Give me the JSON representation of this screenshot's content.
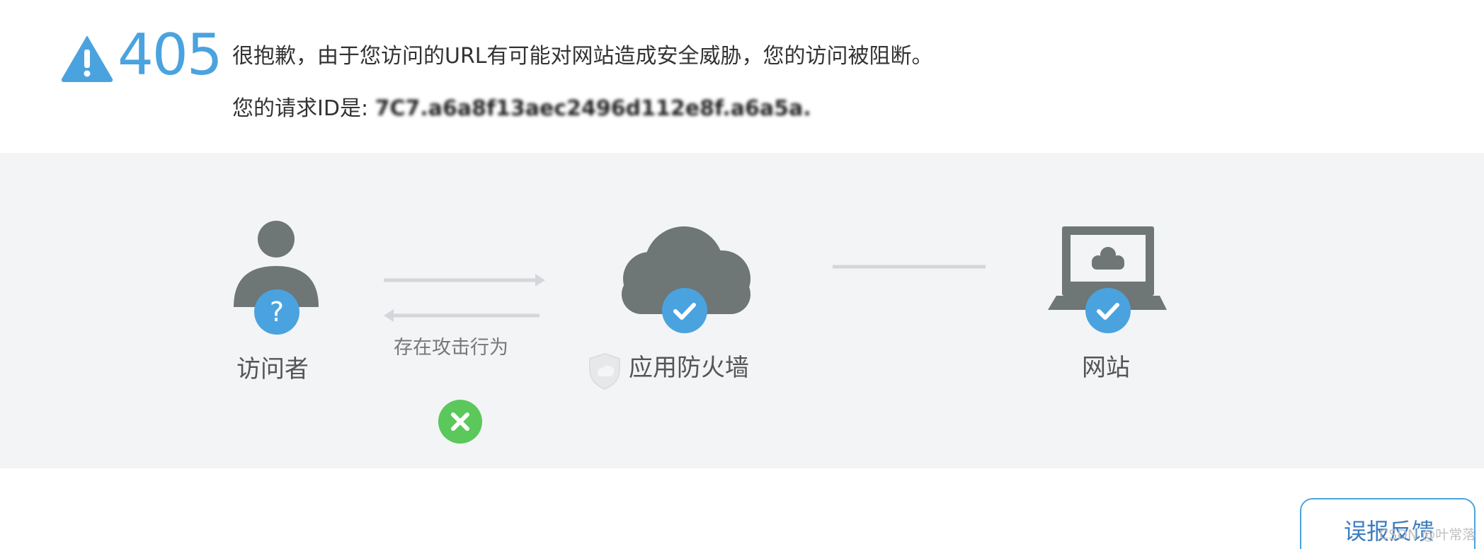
{
  "header": {
    "error_code": "405",
    "message": "很抱歉，由于您访问的URL有可能对网站造成安全威胁，您的访问被阻断。",
    "request_id_label": "您的请求ID是: ",
    "request_id_value": "7C7.a6a8f13aec2496d112e8f.a6a5a."
  },
  "flow": {
    "visitor": {
      "label": "访问者",
      "icon": "user-icon",
      "badge": "question-mark-icon"
    },
    "attack_label": "存在攻击行为",
    "firewall": {
      "label": "应用防火墙",
      "icon": "cloud-icon",
      "badge": "check-icon",
      "label_icon": "shield-icon"
    },
    "website": {
      "label": "网站",
      "icon": "laptop-icon",
      "badge": "check-icon"
    }
  },
  "feedback_button": {
    "label": "误报反馈"
  },
  "watermark": "CSDN @叶常落",
  "colors": {
    "accent_blue": "#4aa3df",
    "block_green": "#5ac85a",
    "icon_gray": "#6e7676",
    "flow_background": "#f3f4f6"
  }
}
